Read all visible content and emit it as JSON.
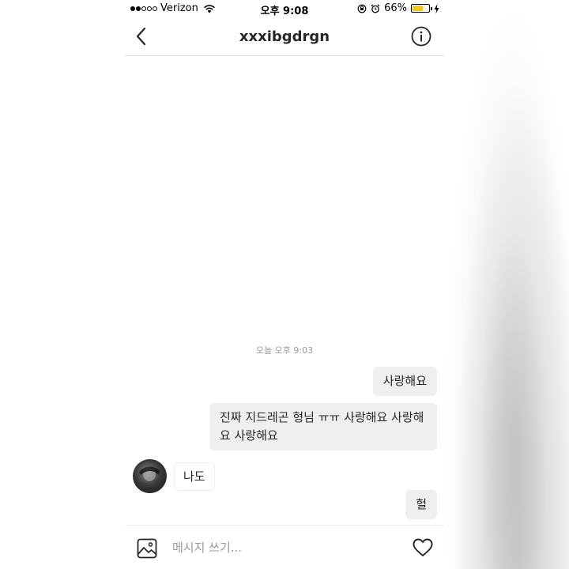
{
  "status_bar": {
    "carrier": "Verizon",
    "time": "오후 9:08",
    "battery_percent": "66%",
    "battery_level": 0.66,
    "signal_bars_filled": 2,
    "signal_bars_total": 5,
    "battery_color": "#f3c51f"
  },
  "header": {
    "title": "xxxibgdrgn",
    "back_icon": "chevron-left-icon",
    "info_icon": "info-icon"
  },
  "conversation": {
    "timestamp": "오늘 오후 9:03",
    "messages": [
      {
        "direction": "sent",
        "text": "사랑해요"
      },
      {
        "direction": "sent",
        "text": "진짜 지드레곤 형님 ㅠㅠ 사랑해요 사랑해요 사랑해요"
      },
      {
        "direction": "received",
        "text": "나도"
      },
      {
        "direction": "sent",
        "text": "헐"
      }
    ]
  },
  "composer": {
    "placeholder": "메시지 쓰기...",
    "value": "",
    "gallery_icon": "image-icon",
    "like_icon": "heart-icon"
  },
  "colors": {
    "sent_bubble": "#efefef",
    "text": "#262626",
    "muted": "#999999",
    "divider": "#dbdbdb"
  }
}
